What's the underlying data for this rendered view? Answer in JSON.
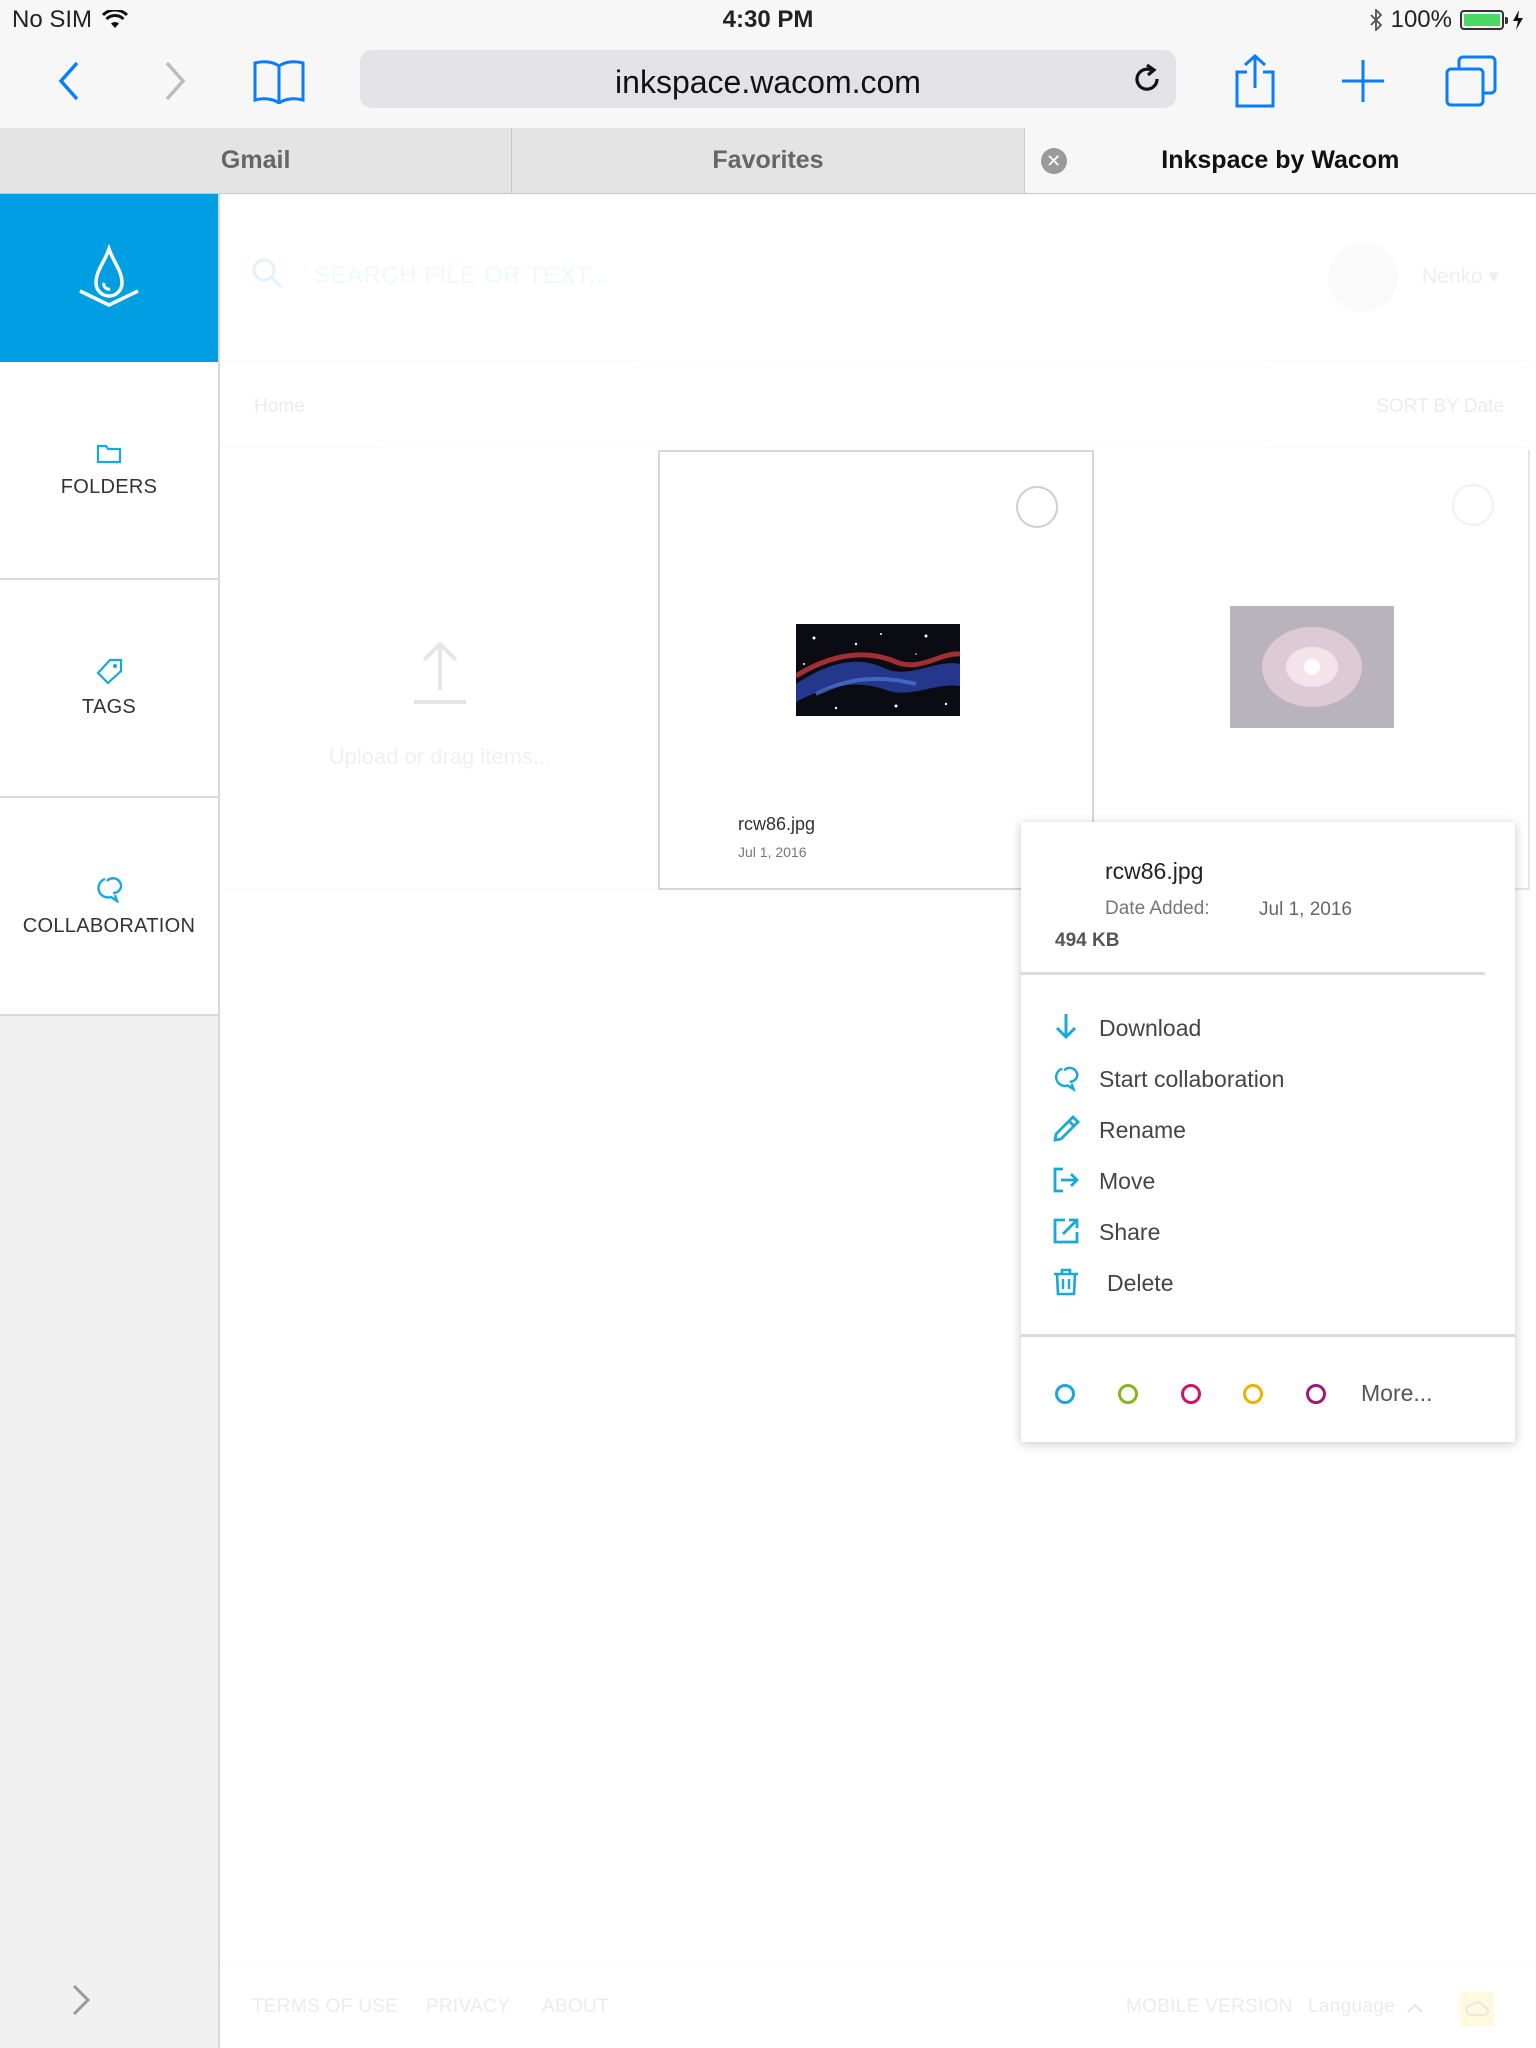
{
  "status_bar": {
    "carrier": "No SIM",
    "time": "4:30 PM",
    "battery": "100%",
    "battery_level": 1.0
  },
  "browser": {
    "url": "inkspace.wacom.com",
    "tabs": [
      {
        "label": "Gmail"
      },
      {
        "label": "Favorites"
      },
      {
        "label": "Inkspace by Wacom"
      }
    ]
  },
  "sidebar": {
    "items": [
      {
        "label": "FOLDERS"
      },
      {
        "label": "TAGS"
      },
      {
        "label": "COLLABORATION"
      }
    ]
  },
  "search": {
    "placeholder": "SEARCH FILE OR TEXT..."
  },
  "user": {
    "name": "Nenko ▾"
  },
  "breadcrumb": {
    "home": "Home"
  },
  "sort": {
    "label": "SORT BY Date"
  },
  "upload": {
    "label": "Upload or drag items..."
  },
  "files": [
    {
      "name": "rcw86.jpg",
      "date": "Jul 1, 2016"
    }
  ],
  "popover": {
    "file_name": "rcw86.jpg",
    "date_label": "Date Added:",
    "date_value": "Jul 1, 2016",
    "size": "494 KB",
    "actions": [
      {
        "label": "Download"
      },
      {
        "label": "Start collaboration"
      },
      {
        "label": "Rename"
      },
      {
        "label": "Move"
      },
      {
        "label": "Share"
      },
      {
        "label": "Delete"
      }
    ],
    "tag_colors": [
      "#1aa7d9",
      "#8ab31e",
      "#d0146b",
      "#e8b400",
      "#9c1a7c"
    ],
    "more_label": "More..."
  },
  "footer": {
    "terms": "TERMS OF USE",
    "privacy": "PRIVACY",
    "about": "ABOUT",
    "mobile": "MOBILE VERSION",
    "language": "Language"
  },
  "colors": {
    "accent": "#009fe3",
    "icon_blue": "#1aa7d9"
  }
}
